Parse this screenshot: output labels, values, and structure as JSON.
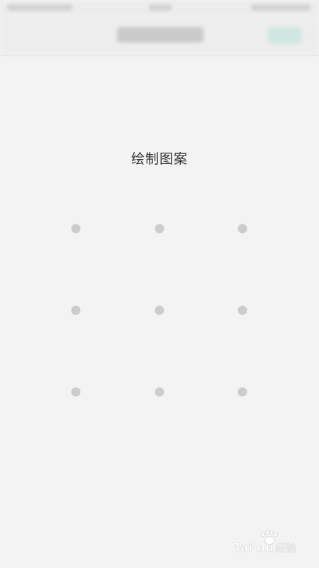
{
  "screen": {
    "prompt": "绘制图案"
  },
  "pattern": {
    "rows": 3,
    "cols": 3,
    "dot_color": "#cccccc"
  },
  "colors": {
    "background": "#f3f3f3",
    "prompt_text": "#333333",
    "accent": "#cfe7e0"
  },
  "watermark": {
    "text": "Baidu 经验"
  }
}
